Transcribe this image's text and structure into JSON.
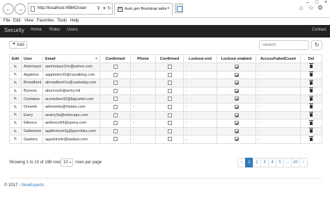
{
  "browser": {
    "url": "http://localhost:49842/user",
    "tab_title": "Auto gen Bootstrap table",
    "menu": [
      "File",
      "Edit",
      "View",
      "Favorites",
      "Tools",
      "Help"
    ]
  },
  "navbar": {
    "brand": "Security",
    "items": [
      "Home",
      "Roles",
      "Users"
    ],
    "right": "Contact"
  },
  "toolbar": {
    "add_label": "Add",
    "search_placeholder": "Search"
  },
  "table": {
    "columns": [
      "Edit",
      "User",
      "Email",
      "Confirmed",
      "Phone",
      "Confirmed",
      "Lockout end",
      "Lockout enabled",
      "AccessFailedCount",
      "Del"
    ],
    "rows": [
      {
        "user": "Antoniazzi",
        "email": "aantoniazzi1m@yahoo.com",
        "confirmed": false,
        "phone": "-",
        "phone_confirmed": false,
        "lockout_end": "-",
        "lockout_enabled": true,
        "access_failed": "-"
      },
      {
        "user": "Appleton",
        "email": "aappleton35@canalblog.com",
        "confirmed": false,
        "phone": "-",
        "phone_confirmed": false,
        "lockout_end": "-",
        "lockout_enabled": true,
        "access_failed": "-"
      },
      {
        "user": "Broadbent",
        "email": "abroadbent1o@usatoday.com",
        "confirmed": false,
        "phone": "-",
        "phone_confirmed": false,
        "lockout_end": "-",
        "lockout_enabled": true,
        "access_failed": "-"
      },
      {
        "user": "Burress",
        "email": "aburress6@army.mil",
        "confirmed": false,
        "phone": "-",
        "phone_confirmed": false,
        "lockout_end": "-",
        "lockout_enabled": true,
        "access_failed": "-"
      },
      {
        "user": "Conisbee",
        "email": "aconisbee32@bigcartel.com",
        "confirmed": false,
        "phone": "-",
        "phone_confirmed": false,
        "lockout_end": "-",
        "lockout_enabled": true,
        "access_failed": "-"
      },
      {
        "user": "Drewett",
        "email": "adrewetto@histats.com",
        "confirmed": false,
        "phone": "-",
        "phone_confirmed": false,
        "lockout_end": "-",
        "lockout_enabled": true,
        "access_failed": "-"
      },
      {
        "user": "Earry",
        "email": "aearry3a@netscape.com",
        "confirmed": false,
        "phone": "-",
        "phone_confirmed": false,
        "lockout_end": "-",
        "lockout_enabled": true,
        "access_failed": "-"
      },
      {
        "user": "Elliesco",
        "email": "aelliesco54@opera.com",
        "confirmed": false,
        "phone": "-",
        "phone_confirmed": false,
        "lockout_end": "-",
        "lockout_enabled": true,
        "access_failed": "-"
      },
      {
        "user": "Gallemore",
        "email": "agallemore2g@geocities.com",
        "confirmed": false,
        "phone": "-",
        "phone_confirmed": false,
        "lockout_end": "-",
        "lockout_enabled": true,
        "access_failed": "-"
      },
      {
        "user": "Gaskins",
        "email": "agaskins4r@taobao.com",
        "confirmed": false,
        "phone": "-",
        "phone_confirmed": false,
        "lockout_end": "-",
        "lockout_enabled": true,
        "access_failed": "-"
      }
    ]
  },
  "pagination": {
    "showing": "Showing 1 to 10 of 198 rows",
    "page_size": "10",
    "rows_per_page": "rows per page",
    "pages": [
      "‹",
      "1",
      "2",
      "3",
      "4",
      "5",
      "...",
      "20",
      "›"
    ],
    "active": "1"
  },
  "footer": {
    "copyright": "© 2017 - ",
    "company": "NewExperts"
  }
}
